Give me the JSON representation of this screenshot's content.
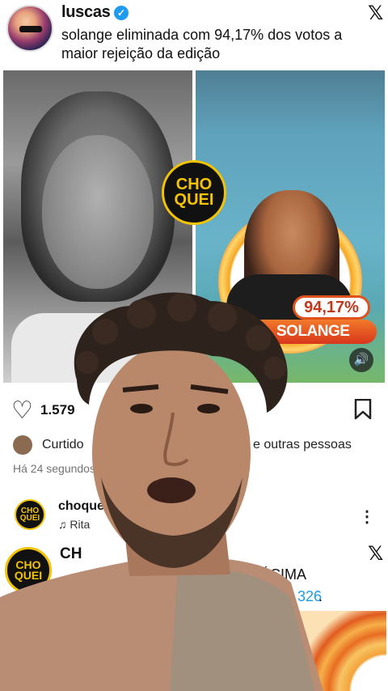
{
  "tweet": {
    "username": "luscas",
    "text": "solange eliminada com 94,17% dos votos a maior rejeição da edição"
  },
  "overlay": {
    "logo_text_top": "CHO",
    "logo_text_bottom": "QUEI",
    "percentage": "94,17%",
    "name": "SOLANGE"
  },
  "post": {
    "likes": "1.579",
    "liked_by_prefix": "Curtido",
    "liked_by_suffix": "e outras pessoas",
    "time": "Há 24 segundos"
  },
  "reel": {
    "username": "choque",
    "music": "Rita"
  },
  "tweet2": {
    "username": "CH",
    "text_fragment": "ÉCIMA",
    "link_fragment": "326",
    "dot": "."
  },
  "icons": [
    "verified-icon",
    "x-logo-icon",
    "heart-icon",
    "bookmark-icon",
    "music-note-icon",
    "more-icon",
    "speaker-icon"
  ],
  "colors": {
    "verified": "#1d9bf0",
    "logo_yellow": "#f4c400",
    "banner_orange": "#e0521c",
    "link_blue": "#1d9bf0"
  }
}
